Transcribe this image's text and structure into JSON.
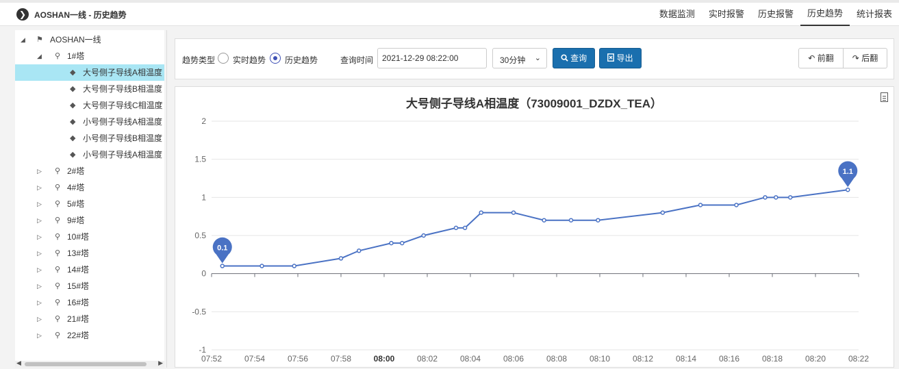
{
  "header": {
    "title": "AOSHAN一线 - 历史趋势",
    "logo_glyph": "❯",
    "tabs": [
      {
        "label": "数据监测",
        "active": false
      },
      {
        "label": "实时报警",
        "active": false
      },
      {
        "label": "历史报警",
        "active": false
      },
      {
        "label": "历史趋势",
        "active": true
      },
      {
        "label": "统计报表",
        "active": false
      }
    ]
  },
  "tree": {
    "root": "AOSHAN一线",
    "tower1": "1#塔",
    "sensors": [
      "大号侧子导线A相温度",
      "大号侧子导线B相温度",
      "大号侧子导线C相温度",
      "小号侧子导线A相温度",
      "小号侧子导线B相温度",
      "小号侧子导线A相温度"
    ],
    "selected_index": 0,
    "towers": [
      "2#塔",
      "4#塔",
      "5#塔",
      "9#塔",
      "10#塔",
      "13#塔",
      "14#塔",
      "15#塔",
      "16#塔",
      "21#塔",
      "22#塔"
    ]
  },
  "toolbar": {
    "trend_type_label": "趋势类型",
    "realtime_label": "实时趋势",
    "history_label": "历史趋势",
    "history_selected": true,
    "query_time_label": "查询时间",
    "query_time_value": "2021-12-29 08:22:00",
    "interval_value": "30分钟",
    "query_button": "查询",
    "export_button": "导出",
    "prev_button": "前翻",
    "next_button": "后翻"
  },
  "colors": {
    "accent": "#1a6fae",
    "series": "#4a72c4",
    "selected_row": "#a9e6f4"
  },
  "chart_data": {
    "type": "line",
    "title": "大号侧子导线A相温度（73009001_DZDX_TEA）",
    "ylim": [
      -1,
      2
    ],
    "yticks": [
      "2",
      "1.5",
      "1",
      "0.5",
      "0",
      "-0.5",
      "-1"
    ],
    "xticks": [
      "07:52",
      "07:54",
      "07:56",
      "07:58",
      "08:00",
      "08:02",
      "08:04",
      "08:06",
      "08:08",
      "08:10",
      "08:12",
      "08:14",
      "08:16",
      "08:18",
      "08:20",
      "08:22"
    ],
    "xtick_bold": "08:00",
    "grid": true,
    "series": [
      {
        "x": [
          "07:52:30",
          "07:54:20",
          "07:55:50",
          "07:58:00",
          "07:58:50",
          "08:00:20",
          "08:00:50",
          "08:01:50",
          "08:03:20",
          "08:03:45",
          "08:04:30",
          "08:06:00",
          "08:07:25",
          "08:08:40",
          "08:09:55",
          "08:12:55",
          "08:14:40",
          "08:16:20",
          "08:17:40",
          "08:18:10",
          "08:18:50",
          "08:21:30"
        ],
        "values": [
          0.1,
          0.1,
          0.1,
          0.2,
          0.3,
          0.4,
          0.4,
          0.5,
          0.6,
          0.6,
          0.8,
          0.8,
          0.7,
          0.7,
          0.7,
          0.8,
          0.9,
          0.9,
          1.0,
          1.0,
          1.0,
          1.1
        ]
      }
    ],
    "markers": [
      {
        "label": "0.1",
        "x": "07:52:30",
        "value": 0.1
      },
      {
        "label": "1.1",
        "x": "08:21:30",
        "value": 1.1
      }
    ]
  }
}
